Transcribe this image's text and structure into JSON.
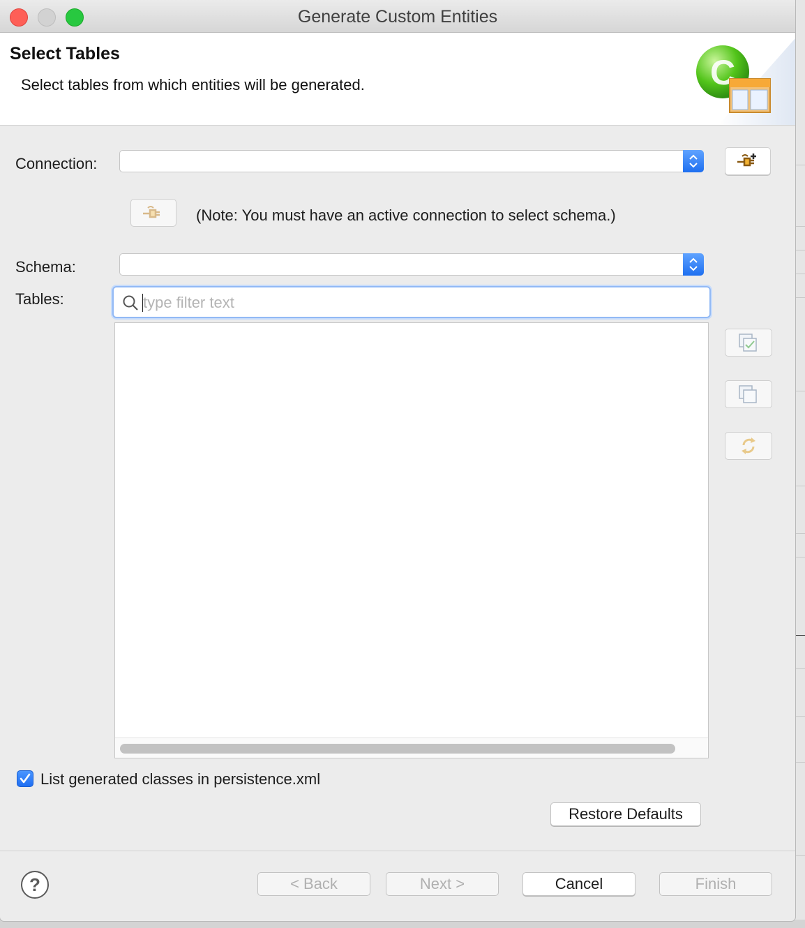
{
  "window": {
    "title": "Generate Custom Entities"
  },
  "header": {
    "title": "Select Tables",
    "description": "Select tables from which entities will be generated."
  },
  "connection": {
    "label": "Connection:",
    "value": ""
  },
  "note": "(Note: You must have an active connection to select schema.)",
  "schema": {
    "label": "Schema:",
    "value": ""
  },
  "tables": {
    "label": "Tables:",
    "filter_placeholder": "type filter text",
    "rows": []
  },
  "options": {
    "list_classes_label": "List generated classes in persistence.xml",
    "list_classes_checked": true,
    "restore_defaults": "Restore Defaults"
  },
  "footer": {
    "help": "?",
    "back": "< Back",
    "next": "Next >",
    "cancel": "Cancel",
    "finish": "Finish"
  },
  "colors": {
    "accent": "#1e6ff0",
    "focus_ring": "#92b9f5",
    "close_light": "#fe5f57",
    "zoom_light": "#28c840"
  },
  "icons": {
    "header": "entity-generation-banner-icon",
    "add_connection": "add-connection-plug-icon",
    "reconnect": "reconnect-plug-icon",
    "search": "search-icon",
    "select_all": "select-all-icon",
    "deselect_all": "deselect-all-icon",
    "refresh": "refresh-icon",
    "checkbox": "checkmark-icon",
    "help": "help-icon"
  }
}
